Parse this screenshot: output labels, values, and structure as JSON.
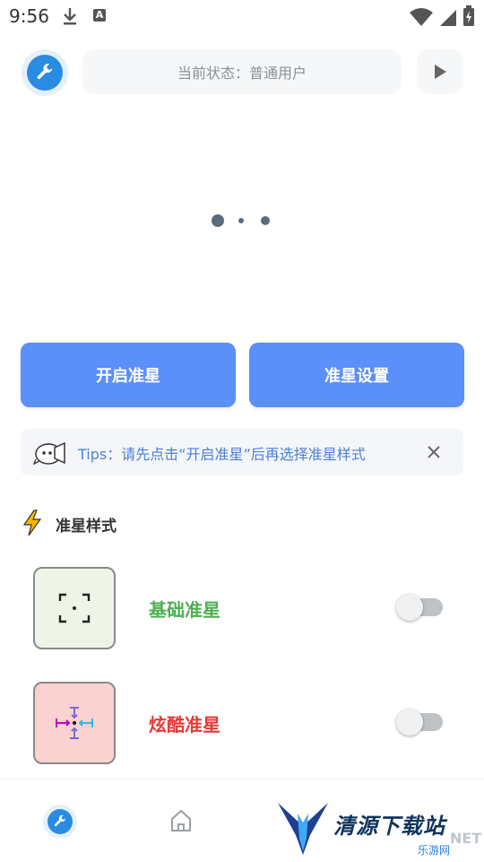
{
  "status_bar": {
    "time": "9:56"
  },
  "header": {
    "status_text": "当前状态：普通用户"
  },
  "carousel": {
    "active_index": 0,
    "count": 3
  },
  "actions": {
    "enable_label": "开启准星",
    "settings_label": "准星设置"
  },
  "tips": {
    "text": "Tips：请先点击“开启准星”后再选择准星样式"
  },
  "section": {
    "title": "准星样式"
  },
  "styles": [
    {
      "name": "基础准星",
      "color": "#4caf50",
      "card_bg": "#eef5e6",
      "enabled": false
    },
    {
      "name": "炫酷准星",
      "color": "#e53935",
      "card_bg": "#fbd2d2",
      "enabled": false
    }
  ],
  "colors": {
    "accent": "#5b8ff9",
    "icon_blue": "#2a8be3"
  },
  "watermark": {
    "text": "清源下载站",
    "net": "NET",
    "sub": "乐游网"
  }
}
